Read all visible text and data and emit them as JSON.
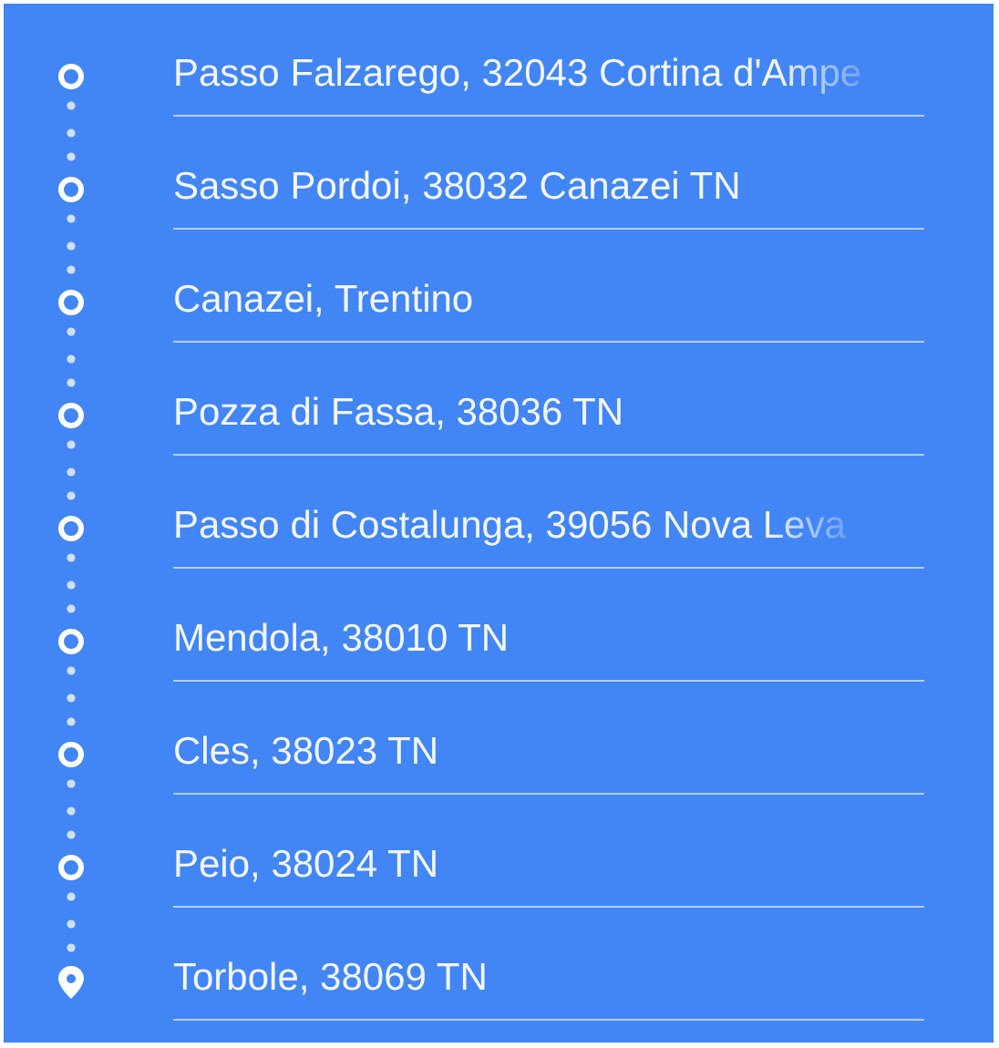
{
  "route": {
    "stops": [
      {
        "kind": "waypoint",
        "label": "Passo Falzarego, 32043 Cortina d'Ampe",
        "truncated": true
      },
      {
        "kind": "waypoint",
        "label": "Sasso Pordoi, 38032 Canazei TN",
        "truncated": false
      },
      {
        "kind": "waypoint",
        "label": "Canazei, Trentino",
        "truncated": false
      },
      {
        "kind": "waypoint",
        "label": "Pozza di Fassa, 38036 TN",
        "truncated": false
      },
      {
        "kind": "waypoint",
        "label": "Passo di Costalunga, 39056 Nova Leva",
        "truncated": true
      },
      {
        "kind": "waypoint",
        "label": "Mendola, 38010 TN",
        "truncated": false
      },
      {
        "kind": "waypoint",
        "label": "Cles, 38023 TN",
        "truncated": false
      },
      {
        "kind": "waypoint",
        "label": "Peio, 38024 TN",
        "truncated": false
      },
      {
        "kind": "destination",
        "label": "Torbole, 38069 TN",
        "truncated": false
      }
    ]
  }
}
